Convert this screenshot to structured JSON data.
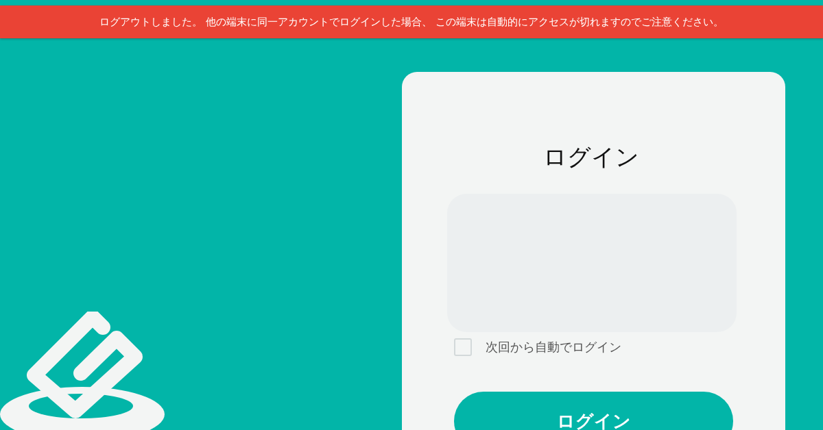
{
  "banner": {
    "message": "ログアウトしました。 他の端末に同一アカウントでログインした場合、 この端末は自動的にアクセスが切れますのでご注意ください。"
  },
  "login": {
    "title": "ログイン",
    "remember": {
      "label": "次回から自動でログイン",
      "checked": false
    },
    "submit": {
      "label": "ログイン"
    }
  }
}
